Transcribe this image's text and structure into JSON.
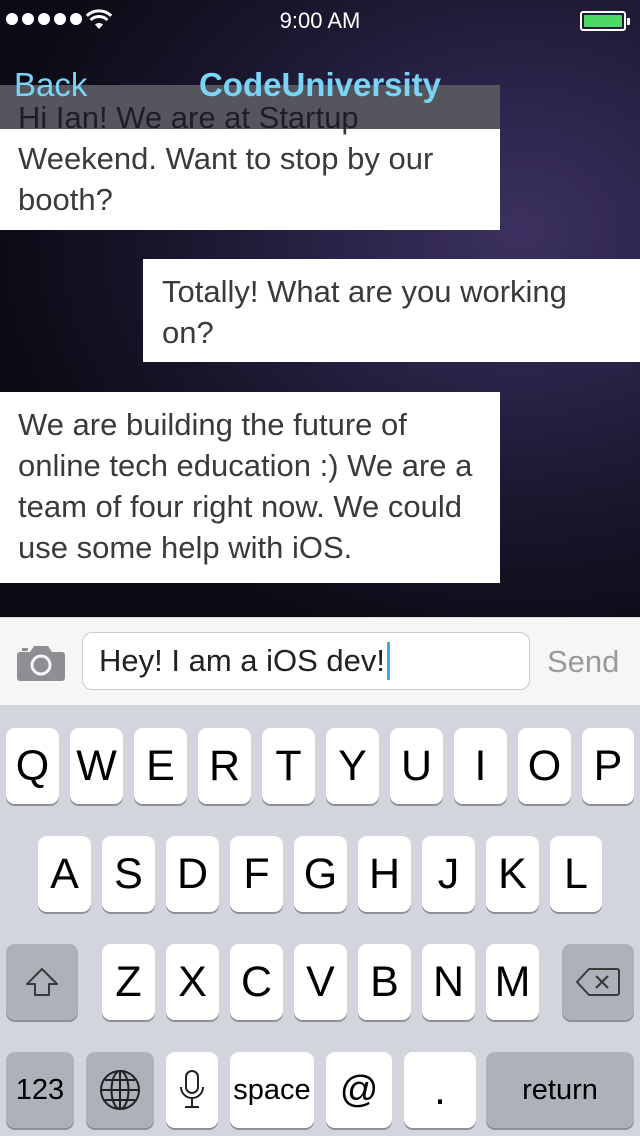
{
  "status_bar": {
    "time": "9:00 AM",
    "signal_bars": 5,
    "battery_color": "#4cd964"
  },
  "nav": {
    "back_label": "Back",
    "title": "CodeUniversity",
    "accent_color": "#7ad4f5"
  },
  "messages": [
    {
      "side": "left",
      "text": "Hi Ian! We are at Startup Weekend. Want to stop by our booth?"
    },
    {
      "side": "right",
      "text": "Totally! What are you working on?"
    },
    {
      "side": "left",
      "text": "We are building the future of online tech education :) We are a team of four right now. We could use some help with iOS."
    }
  ],
  "input": {
    "value": "Hey! I am a iOS dev!",
    "send_label": "Send",
    "camera_icon": "camera-icon"
  },
  "keyboard": {
    "row1": [
      "Q",
      "W",
      "E",
      "R",
      "T",
      "Y",
      "U",
      "I",
      "O",
      "P"
    ],
    "row2": [
      "A",
      "S",
      "D",
      "F",
      "G",
      "H",
      "J",
      "K",
      "L"
    ],
    "row3": [
      "Z",
      "X",
      "C",
      "V",
      "B",
      "N",
      "M"
    ],
    "numbers_label": "123",
    "space_label": "space",
    "at_label": "@",
    "dot_label": ".",
    "return_label": "return",
    "icons": [
      "shift-icon",
      "backspace-icon",
      "globe-icon",
      "microphone-icon"
    ]
  }
}
